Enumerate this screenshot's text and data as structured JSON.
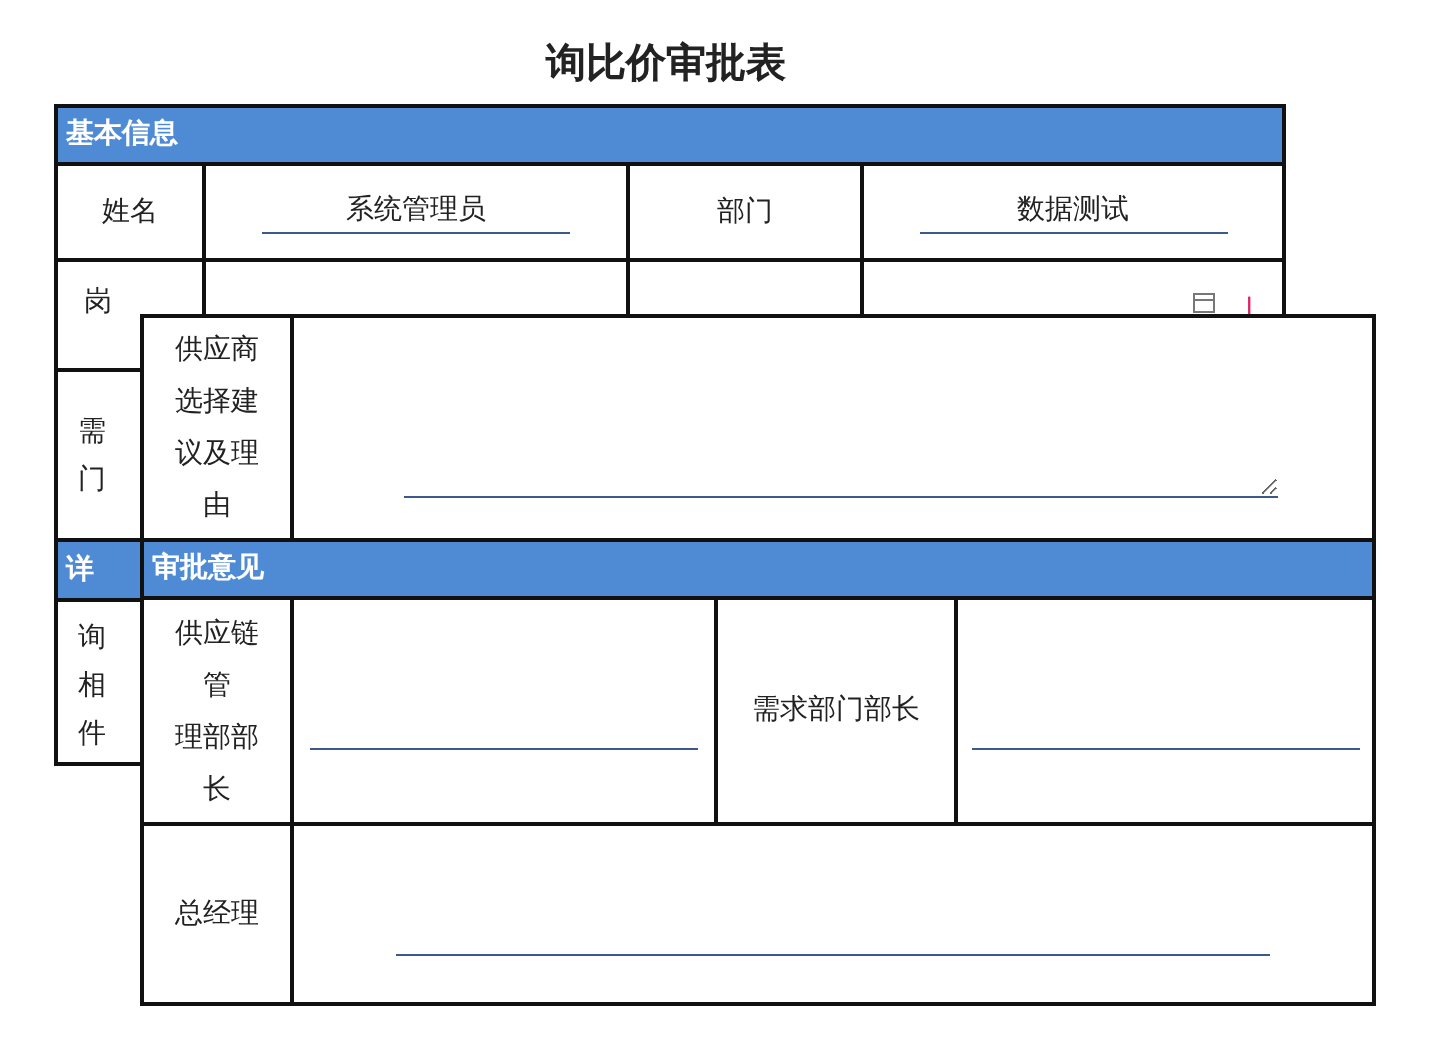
{
  "title": "询比价审批表",
  "basic_info": {
    "header": "基本信息",
    "name_label": "姓名",
    "name_value": "系统管理员",
    "dept_label": "部门",
    "dept_value": "数据测试",
    "position_label": "岗",
    "required_mark": "|",
    "row_3_label_lines": [
      "需",
      "门"
    ]
  },
  "details": {
    "header": "详",
    "label_lines": [
      "询",
      "相",
      "件"
    ]
  },
  "overlay": {
    "supplier_label": "供应商选择建议及理由",
    "approval_header": "审批意见",
    "supply_chain_label_lines": [
      "供应链",
      "管",
      "理部部",
      "长"
    ],
    "demand_head_label": "需求部门部长",
    "general_manager_label": "总经理"
  }
}
